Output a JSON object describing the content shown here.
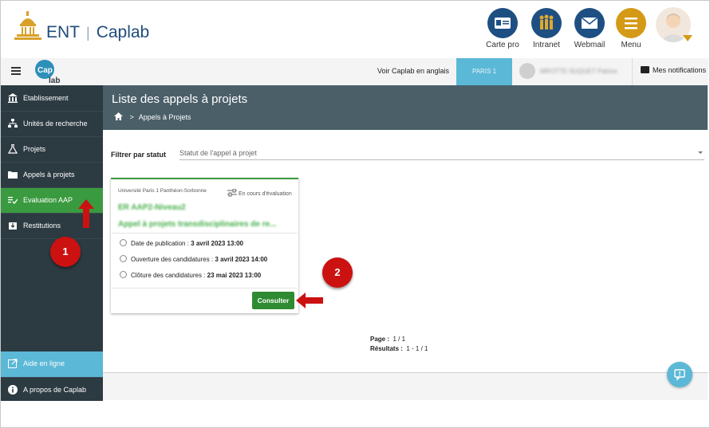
{
  "header": {
    "brand_ent": "ENT",
    "brand_sep": "|",
    "brand_caplab": "Caplab",
    "tools": [
      {
        "label": "Carte pro",
        "icon": "id-card-icon"
      },
      {
        "label": "Intranet",
        "icon": "people-icon"
      },
      {
        "label": "Webmail",
        "icon": "envelope-icon"
      },
      {
        "label": "Menu",
        "icon": "menu-icon"
      }
    ]
  },
  "navbar": {
    "language_link": "Voir Caplab en anglais",
    "institution": "PARIS 1",
    "user_name": "MROTTE-SUQUET Patrice",
    "notifications": "Mes notifications"
  },
  "sidebar": {
    "items": [
      {
        "label": "Etablissement",
        "icon": "bank-icon"
      },
      {
        "label": "Unités de recherche",
        "icon": "hierarchy-icon"
      },
      {
        "label": "Projets",
        "icon": "flask-icon"
      },
      {
        "label": "Appels à projets",
        "icon": "folder-icon"
      },
      {
        "label": "Evaluation AAP",
        "icon": "checklist-icon"
      },
      {
        "label": "Restitutions",
        "icon": "download-box-icon"
      }
    ],
    "help": "Aide en ligne",
    "about": "A propos de Caplab"
  },
  "main": {
    "title": "Liste des appels à projets",
    "breadcrumb": "Appels à Projets",
    "filter_label": "Filtrer par statut",
    "filter_placeholder": "Statut de l'appel à projet"
  },
  "card": {
    "university": "Université Paris 1 Panthéon-Sorbonne",
    "status": "En cours d'évaluation",
    "title_line1": "ER AAP2-Niveau2",
    "title_line2": "Appel à projets transdisciplinaires de re...",
    "publication_label": "Date de publication :",
    "publication_value": "3 avril 2023 13:00",
    "opening_label": "Ouverture des candidatures :",
    "opening_value": "3 avril 2023 14:00",
    "closing_label": "Clôture des candidatures :",
    "closing_value": "23 mai 2023 13:00",
    "button": "Consulter"
  },
  "pagination": {
    "page_label": "Page :",
    "page_value": "1 / 1",
    "results_label": "Résultats :",
    "results_value": "1 - 1 / 1"
  },
  "annotations": {
    "step1": "1",
    "step2": "2"
  },
  "colors": {
    "sidebar_bg": "#2c3a42",
    "active_green": "#3a9a3f",
    "accent_blue": "#5bb8d6",
    "brand_blue": "#1f4b7a",
    "menu_gold": "#d49a16",
    "annotation_red": "#cc1111"
  }
}
